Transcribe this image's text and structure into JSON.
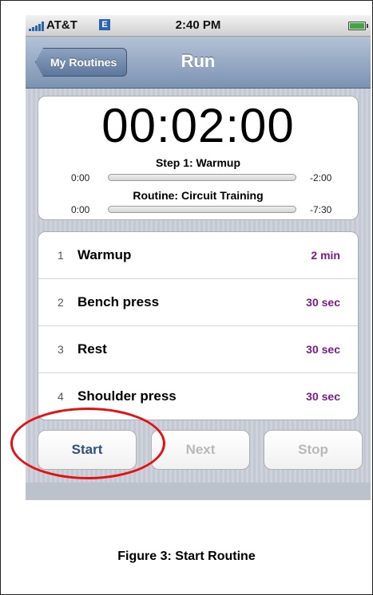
{
  "status_bar": {
    "carrier": "AT&T",
    "network": "E",
    "time": "2:40 PM",
    "battery_level": 1.0
  },
  "nav": {
    "back_label": "My Routines",
    "title": "Run"
  },
  "timer": {
    "display": "00:02:00",
    "step_label": "Step 1: Warmup",
    "step_elapsed": "0:00",
    "step_remaining": "-2:00",
    "step_progress": 0,
    "routine_label": "Routine: Circuit Training",
    "routine_elapsed": "0:00",
    "routine_remaining": "-7:30",
    "routine_progress": 0
  },
  "steps": [
    {
      "num": "1",
      "name": "Warmup",
      "duration": "2 min"
    },
    {
      "num": "2",
      "name": "Bench press",
      "duration": "30 sec"
    },
    {
      "num": "3",
      "name": "Rest",
      "duration": "30 sec"
    },
    {
      "num": "4",
      "name": "Shoulder press",
      "duration": "30 sec"
    }
  ],
  "actions": {
    "start": "Start",
    "next": "Next",
    "stop": "Stop"
  },
  "caption": "Figure 3:  Start Routine",
  "colors": {
    "highlight": "#e31212",
    "duration_text": "#7a1a8a",
    "nav_bar": "#7b93b3"
  },
  "icons": [
    "signal-bars-icon",
    "edge-network-icon",
    "battery-icon",
    "back-chevron-icon"
  ]
}
